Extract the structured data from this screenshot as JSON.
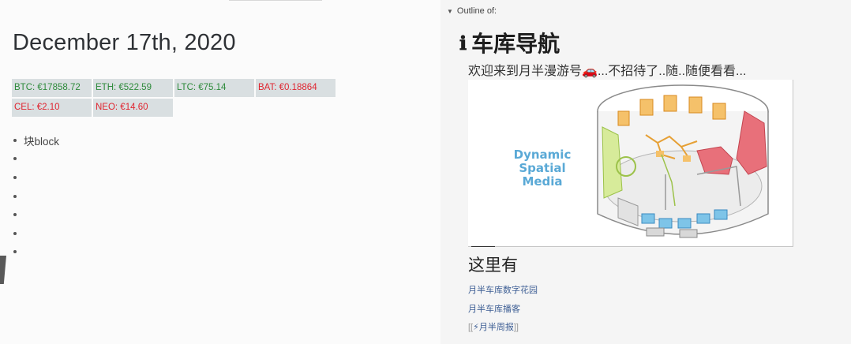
{
  "journal": {
    "title": "December 17th, 2020",
    "crypto": [
      {
        "label": "BTC: €17858.72",
        "trend": "up"
      },
      {
        "label": "ETH: €522.59",
        "trend": "up"
      },
      {
        "label": "LTC: €75.14",
        "trend": "up"
      },
      {
        "label": "BAT: €0.18864",
        "trend": "down"
      },
      {
        "label": "CEL: €2.10",
        "trend": "down"
      },
      {
        "label": "NEO: €14.60",
        "trend": "down"
      }
    ],
    "blocks": [
      "块block",
      "",
      "",
      "",
      "",
      "",
      ""
    ]
  },
  "sidebar": {
    "outline_label": "Outline of:",
    "info_icon": "ℹ",
    "page_title": "车库导航",
    "welcome_pre": "欢迎来到月半漫游号",
    "welcome_icon": "🚗",
    "welcome_post": "...不招待了..随..随便看看...",
    "diagram_text": [
      "Dynamic",
      "Spatial",
      "Media"
    ],
    "section_heading": "这里有",
    "links": [
      "月半车库数字花园",
      "月半车库播客"
    ],
    "ref_open": "[[",
    "ref_label": "⚡月半周报",
    "ref_close": "]]"
  },
  "colors": {
    "up": "#2d8a3a",
    "down": "#e0242f",
    "link": "#3d5e94",
    "cell_bg": "#d9dfe1",
    "diagram_text": "#5aa9d6"
  }
}
